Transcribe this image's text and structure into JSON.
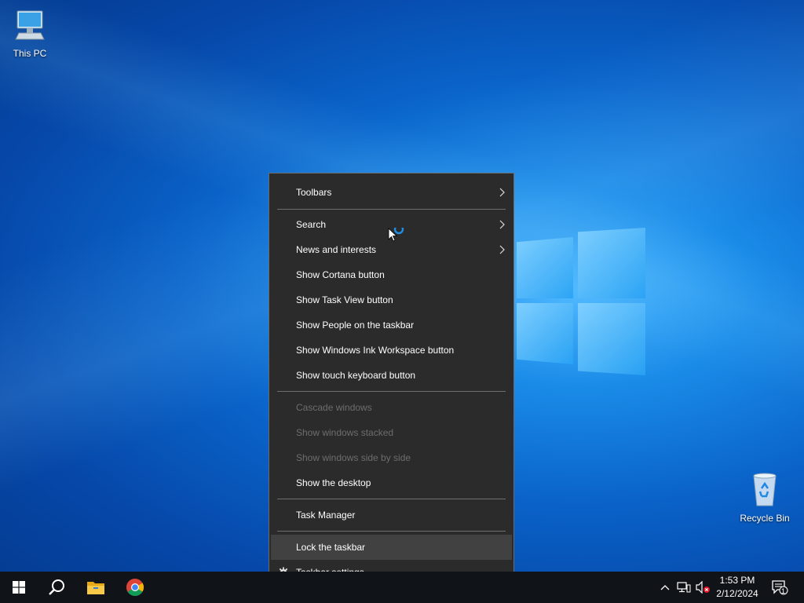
{
  "desktop": {
    "icons": [
      {
        "label": "This PC",
        "icon": "computer-icon"
      },
      {
        "label": "Recycle Bin",
        "icon": "recycle-bin-icon"
      }
    ]
  },
  "context_menu": {
    "items": [
      {
        "label": "Toolbars",
        "submenu": true
      },
      {
        "label": "Search",
        "submenu": true
      },
      {
        "label": "News and interests",
        "submenu": true
      },
      {
        "label": "Show Cortana button"
      },
      {
        "label": "Show Task View button"
      },
      {
        "label": "Show People on the taskbar"
      },
      {
        "label": "Show Windows Ink Workspace button"
      },
      {
        "label": "Show touch keyboard button"
      },
      {
        "label": "Cascade windows",
        "disabled": true
      },
      {
        "label": "Show windows stacked",
        "disabled": true
      },
      {
        "label": "Show windows side by side",
        "disabled": true
      },
      {
        "label": "Show the desktop"
      },
      {
        "label": "Task Manager"
      },
      {
        "label": "Lock the taskbar",
        "highlighted": true
      },
      {
        "label": "Taskbar settings",
        "icon": "gear-icon"
      }
    ]
  },
  "taskbar": {
    "pinned": [
      "windows-start-icon",
      "search-icon",
      "file-explorer-icon",
      "chrome-icon"
    ],
    "tray_icons": [
      "chevron-up-icon",
      "network-icon",
      "volume-muted-icon"
    ],
    "clock": {
      "time": "1:53 PM",
      "date": "2/12/2024"
    },
    "notifications_count": "1"
  },
  "colors": {
    "menu_bg": "#2b2b2b",
    "menu_highlight": "#414141",
    "taskbar_bg": "#101418"
  }
}
